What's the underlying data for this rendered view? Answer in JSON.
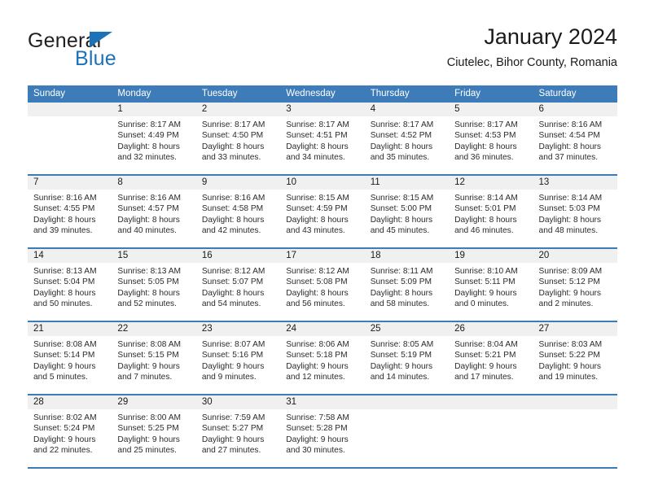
{
  "brand": {
    "name_part1": "General",
    "name_part2": "Blue"
  },
  "header": {
    "title": "January 2024",
    "subtitle": "Ciutelec, Bihor County, Romania"
  },
  "colors": {
    "header_blue": "#3d7cb8",
    "brand_blue": "#1c72b8",
    "daynum_band": "#f0f0f0",
    "text": "#1a1a1a"
  },
  "weekday_headers": [
    "Sunday",
    "Monday",
    "Tuesday",
    "Wednesday",
    "Thursday",
    "Friday",
    "Saturday"
  ],
  "weeks": [
    [
      {
        "day": "",
        "sunrise": "",
        "sunset": "",
        "daylight1": "",
        "daylight2": ""
      },
      {
        "day": "1",
        "sunrise": "Sunrise: 8:17 AM",
        "sunset": "Sunset: 4:49 PM",
        "daylight1": "Daylight: 8 hours",
        "daylight2": "and 32 minutes."
      },
      {
        "day": "2",
        "sunrise": "Sunrise: 8:17 AM",
        "sunset": "Sunset: 4:50 PM",
        "daylight1": "Daylight: 8 hours",
        "daylight2": "and 33 minutes."
      },
      {
        "day": "3",
        "sunrise": "Sunrise: 8:17 AM",
        "sunset": "Sunset: 4:51 PM",
        "daylight1": "Daylight: 8 hours",
        "daylight2": "and 34 minutes."
      },
      {
        "day": "4",
        "sunrise": "Sunrise: 8:17 AM",
        "sunset": "Sunset: 4:52 PM",
        "daylight1": "Daylight: 8 hours",
        "daylight2": "and 35 minutes."
      },
      {
        "day": "5",
        "sunrise": "Sunrise: 8:17 AM",
        "sunset": "Sunset: 4:53 PM",
        "daylight1": "Daylight: 8 hours",
        "daylight2": "and 36 minutes."
      },
      {
        "day": "6",
        "sunrise": "Sunrise: 8:16 AM",
        "sunset": "Sunset: 4:54 PM",
        "daylight1": "Daylight: 8 hours",
        "daylight2": "and 37 minutes."
      }
    ],
    [
      {
        "day": "7",
        "sunrise": "Sunrise: 8:16 AM",
        "sunset": "Sunset: 4:55 PM",
        "daylight1": "Daylight: 8 hours",
        "daylight2": "and 39 minutes."
      },
      {
        "day": "8",
        "sunrise": "Sunrise: 8:16 AM",
        "sunset": "Sunset: 4:57 PM",
        "daylight1": "Daylight: 8 hours",
        "daylight2": "and 40 minutes."
      },
      {
        "day": "9",
        "sunrise": "Sunrise: 8:16 AM",
        "sunset": "Sunset: 4:58 PM",
        "daylight1": "Daylight: 8 hours",
        "daylight2": "and 42 minutes."
      },
      {
        "day": "10",
        "sunrise": "Sunrise: 8:15 AM",
        "sunset": "Sunset: 4:59 PM",
        "daylight1": "Daylight: 8 hours",
        "daylight2": "and 43 minutes."
      },
      {
        "day": "11",
        "sunrise": "Sunrise: 8:15 AM",
        "sunset": "Sunset: 5:00 PM",
        "daylight1": "Daylight: 8 hours",
        "daylight2": "and 45 minutes."
      },
      {
        "day": "12",
        "sunrise": "Sunrise: 8:14 AM",
        "sunset": "Sunset: 5:01 PM",
        "daylight1": "Daylight: 8 hours",
        "daylight2": "and 46 minutes."
      },
      {
        "day": "13",
        "sunrise": "Sunrise: 8:14 AM",
        "sunset": "Sunset: 5:03 PM",
        "daylight1": "Daylight: 8 hours",
        "daylight2": "and 48 minutes."
      }
    ],
    [
      {
        "day": "14",
        "sunrise": "Sunrise: 8:13 AM",
        "sunset": "Sunset: 5:04 PM",
        "daylight1": "Daylight: 8 hours",
        "daylight2": "and 50 minutes."
      },
      {
        "day": "15",
        "sunrise": "Sunrise: 8:13 AM",
        "sunset": "Sunset: 5:05 PM",
        "daylight1": "Daylight: 8 hours",
        "daylight2": "and 52 minutes."
      },
      {
        "day": "16",
        "sunrise": "Sunrise: 8:12 AM",
        "sunset": "Sunset: 5:07 PM",
        "daylight1": "Daylight: 8 hours",
        "daylight2": "and 54 minutes."
      },
      {
        "day": "17",
        "sunrise": "Sunrise: 8:12 AM",
        "sunset": "Sunset: 5:08 PM",
        "daylight1": "Daylight: 8 hours",
        "daylight2": "and 56 minutes."
      },
      {
        "day": "18",
        "sunrise": "Sunrise: 8:11 AM",
        "sunset": "Sunset: 5:09 PM",
        "daylight1": "Daylight: 8 hours",
        "daylight2": "and 58 minutes."
      },
      {
        "day": "19",
        "sunrise": "Sunrise: 8:10 AM",
        "sunset": "Sunset: 5:11 PM",
        "daylight1": "Daylight: 9 hours",
        "daylight2": "and 0 minutes."
      },
      {
        "day": "20",
        "sunrise": "Sunrise: 8:09 AM",
        "sunset": "Sunset: 5:12 PM",
        "daylight1": "Daylight: 9 hours",
        "daylight2": "and 2 minutes."
      }
    ],
    [
      {
        "day": "21",
        "sunrise": "Sunrise: 8:08 AM",
        "sunset": "Sunset: 5:14 PM",
        "daylight1": "Daylight: 9 hours",
        "daylight2": "and 5 minutes."
      },
      {
        "day": "22",
        "sunrise": "Sunrise: 8:08 AM",
        "sunset": "Sunset: 5:15 PM",
        "daylight1": "Daylight: 9 hours",
        "daylight2": "and 7 minutes."
      },
      {
        "day": "23",
        "sunrise": "Sunrise: 8:07 AM",
        "sunset": "Sunset: 5:16 PM",
        "daylight1": "Daylight: 9 hours",
        "daylight2": "and 9 minutes."
      },
      {
        "day": "24",
        "sunrise": "Sunrise: 8:06 AM",
        "sunset": "Sunset: 5:18 PM",
        "daylight1": "Daylight: 9 hours",
        "daylight2": "and 12 minutes."
      },
      {
        "day": "25",
        "sunrise": "Sunrise: 8:05 AM",
        "sunset": "Sunset: 5:19 PM",
        "daylight1": "Daylight: 9 hours",
        "daylight2": "and 14 minutes."
      },
      {
        "day": "26",
        "sunrise": "Sunrise: 8:04 AM",
        "sunset": "Sunset: 5:21 PM",
        "daylight1": "Daylight: 9 hours",
        "daylight2": "and 17 minutes."
      },
      {
        "day": "27",
        "sunrise": "Sunrise: 8:03 AM",
        "sunset": "Sunset: 5:22 PM",
        "daylight1": "Daylight: 9 hours",
        "daylight2": "and 19 minutes."
      }
    ],
    [
      {
        "day": "28",
        "sunrise": "Sunrise: 8:02 AM",
        "sunset": "Sunset: 5:24 PM",
        "daylight1": "Daylight: 9 hours",
        "daylight2": "and 22 minutes."
      },
      {
        "day": "29",
        "sunrise": "Sunrise: 8:00 AM",
        "sunset": "Sunset: 5:25 PM",
        "daylight1": "Daylight: 9 hours",
        "daylight2": "and 25 minutes."
      },
      {
        "day": "30",
        "sunrise": "Sunrise: 7:59 AM",
        "sunset": "Sunset: 5:27 PM",
        "daylight1": "Daylight: 9 hours",
        "daylight2": "and 27 minutes."
      },
      {
        "day": "31",
        "sunrise": "Sunrise: 7:58 AM",
        "sunset": "Sunset: 5:28 PM",
        "daylight1": "Daylight: 9 hours",
        "daylight2": "and 30 minutes."
      },
      {
        "day": "",
        "sunrise": "",
        "sunset": "",
        "daylight1": "",
        "daylight2": ""
      },
      {
        "day": "",
        "sunrise": "",
        "sunset": "",
        "daylight1": "",
        "daylight2": ""
      },
      {
        "day": "",
        "sunrise": "",
        "sunset": "",
        "daylight1": "",
        "daylight2": ""
      }
    ]
  ]
}
